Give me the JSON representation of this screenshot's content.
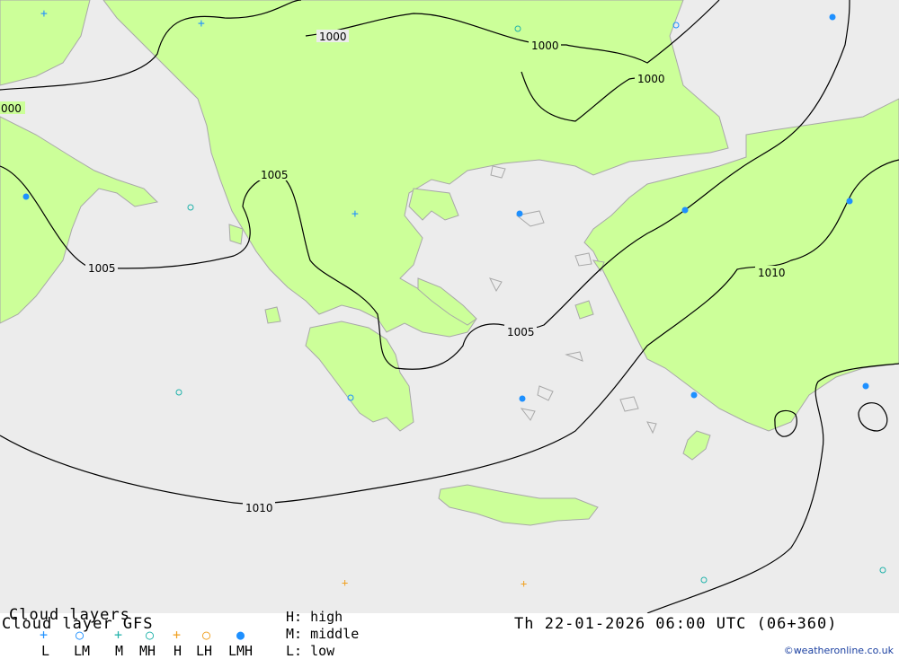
{
  "map": {
    "isobars": [
      {
        "label": "1000"
      },
      {
        "label": "1000"
      },
      {
        "label": "1000"
      },
      {
        "label": "000"
      },
      {
        "label": "1005"
      },
      {
        "label": "1005"
      },
      {
        "label": "1005"
      },
      {
        "label": "1010"
      },
      {
        "label": "1010"
      }
    ],
    "colors": {
      "sea": "#ececec",
      "land": "#ccff99",
      "border": "#a8a8a8",
      "isobar": "#000000",
      "cloud_blue": "#1e90ff",
      "cloud_teal": "#20b2aa",
      "cloud_orange": "#f0a020"
    }
  },
  "legend": {
    "title1": "Cloud layers",
    "title2": "Cloud layer  GFS",
    "keys": [
      "L",
      "LM",
      "M",
      "MH",
      "H",
      "LH",
      "LMH"
    ],
    "h_text": "H: high",
    "m_text": "M: middle",
    "l_text": "L: low",
    "datetime": "Th 22-01-2026 06:00 UTC (06+360)",
    "credit": "©weatheronline.co.uk"
  }
}
